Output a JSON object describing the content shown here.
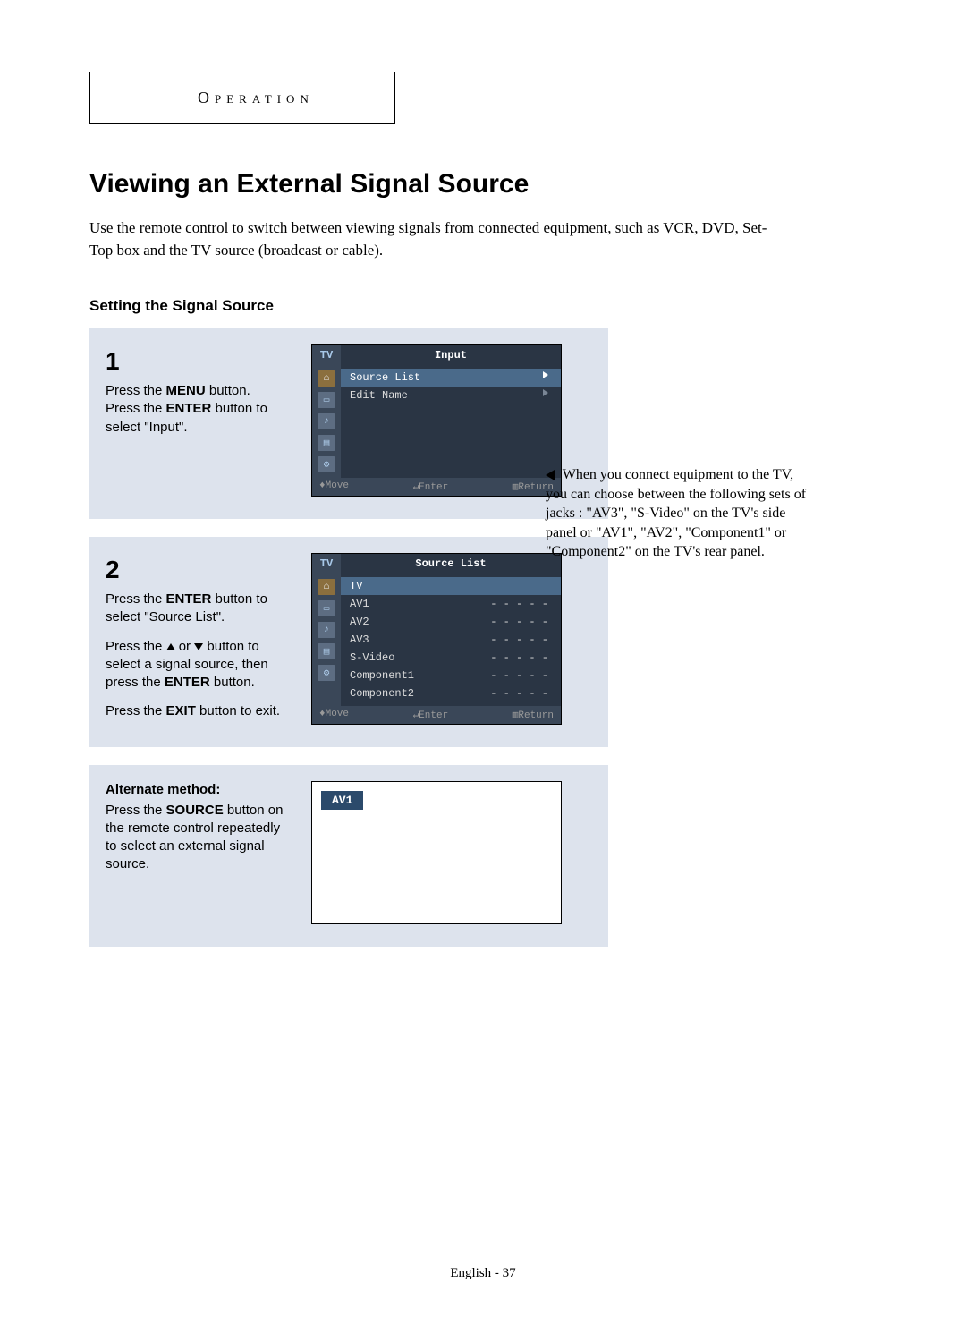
{
  "header": {
    "section": "Operation"
  },
  "title": "Viewing an External Signal Source",
  "intro": "Use the remote control to switch between viewing signals from connected equipment, such as VCR, DVD, Set-Top box and the TV source (broadcast or cable).",
  "subheading": "Setting the Signal Source",
  "step1": {
    "num": "1",
    "l1a": "Press the ",
    "l1b": "MENU",
    "l1c": " button.",
    "l2a": "Press the ",
    "l2b": "ENTER",
    "l2c": " button to select \"Input\".",
    "menu": {
      "tv": "TV",
      "title": "Input",
      "items": {
        "sourceList": "Source List",
        "editName": "Edit Name"
      },
      "sym": "√",
      "footer": {
        "move": "♦Move",
        "enter": "↵Enter",
        "return": "▥Return"
      }
    }
  },
  "step2": {
    "num": "2",
    "l1a": "Press the ",
    "l1b": "ENTER",
    "l1c": " button to select \"Source List\".",
    "l2a": "Press the ",
    "l2b": " or ",
    "l2c": " button to select a signal source, then press the ",
    "l2d": "ENTER",
    "l2e": " button.",
    "l3a": "Press the ",
    "l3b": "EXIT",
    "l3c": " button to exit.",
    "menu": {
      "tv": "TV",
      "title": "Source List",
      "items": {
        "tv": "TV",
        "av1": "AV1",
        "av2": "AV2",
        "av3": "AV3",
        "svideo": "S-Video",
        "comp1": "Component1",
        "comp2": "Component2"
      },
      "dash": "- - - - -",
      "footer": {
        "move": "♦Move",
        "enter": "↵Enter",
        "return": "▥Return"
      }
    }
  },
  "alt": {
    "heading": "Alternate method:",
    "l1a": "Press the ",
    "l1b": "SOURCE",
    "l1c": " button on the remote control repeatedly to select an external signal source.",
    "badge": "AV1"
  },
  "sidenote": " When you connect equipment to the TV, you can choose between the following sets of jacks : \"AV3\", \"S-Video\" on the TV's side panel or \"AV1\", \"AV2\", \"Component1\" or \"Component2\" on the TV's rear panel.",
  "pagenum": "English - 37"
}
